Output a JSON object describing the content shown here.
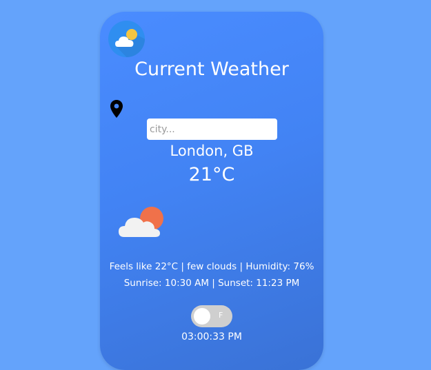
{
  "app": {
    "title": "Current Weather",
    "logo_icon": "partly-cloudy-logo-icon",
    "location_icon": "map-pin-icon"
  },
  "search": {
    "placeholder": "city..."
  },
  "weather": {
    "location": "London, GB",
    "temperature": "21°C",
    "condition_icon": "cloud-sun-icon",
    "details_line1": "Feels like 22°C | few clouds | Humidity: 76%",
    "details_line2": "Sunrise: 10:30 AM | Sunset: 11:23 PM"
  },
  "units_toggle": {
    "label": "F",
    "state": "off"
  },
  "clock": {
    "time": "03:00:33 PM"
  },
  "colors": {
    "page_background": "#64a3fb",
    "card_top": "#4a8cff",
    "card_bottom": "#3a72d6",
    "sun": "#f0714a",
    "toggle_track": "#cfcfcf"
  }
}
